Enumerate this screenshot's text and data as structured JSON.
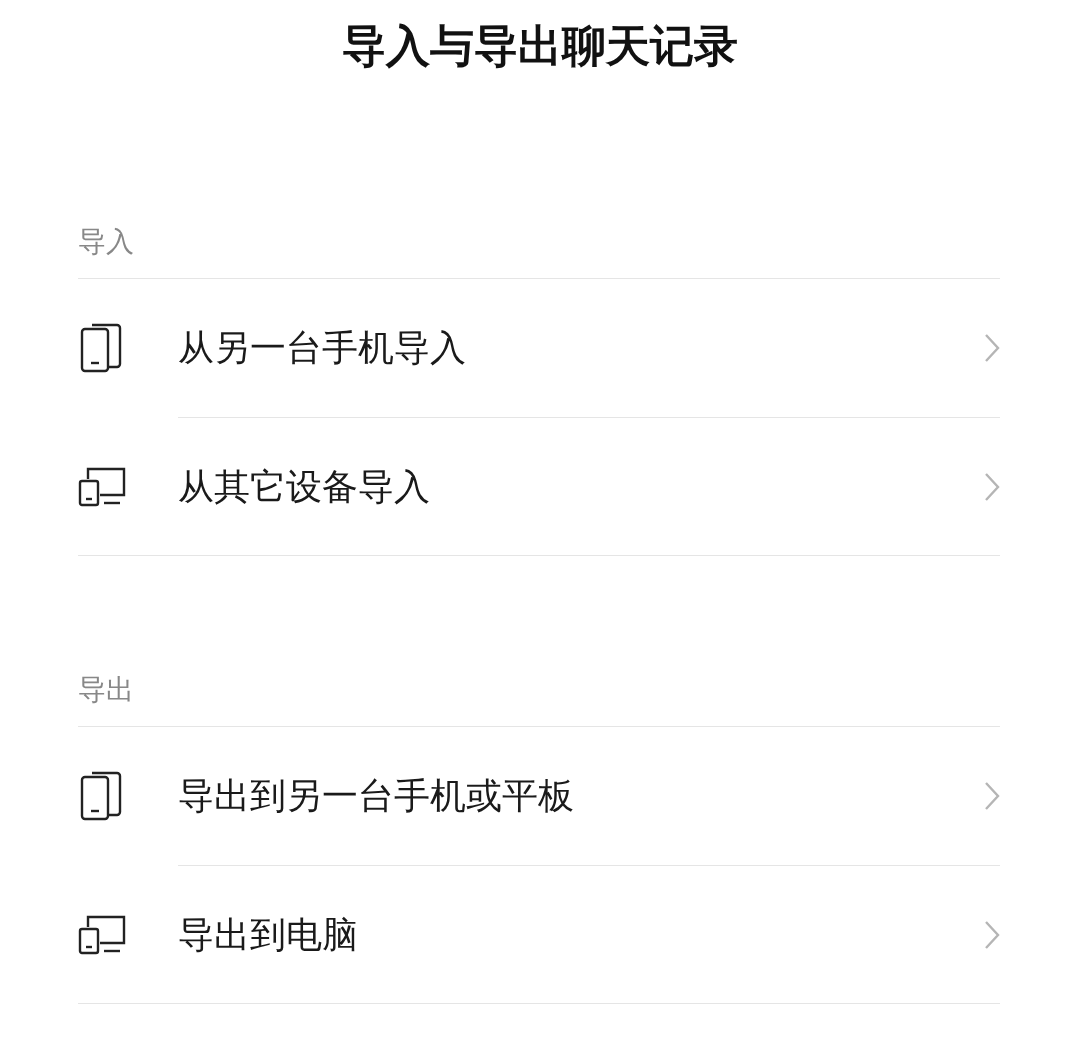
{
  "title": "导入与导出聊天记录",
  "sections": [
    {
      "label": "导入",
      "items": [
        {
          "label": "从另一台手机导入",
          "kind": "phone"
        },
        {
          "label": "从其它设备导入",
          "kind": "devices"
        }
      ]
    },
    {
      "label": "导出",
      "items": [
        {
          "label": "导出到另一台手机或平板",
          "kind": "phone"
        },
        {
          "label": "导出到电脑",
          "kind": "devices"
        }
      ]
    }
  ]
}
